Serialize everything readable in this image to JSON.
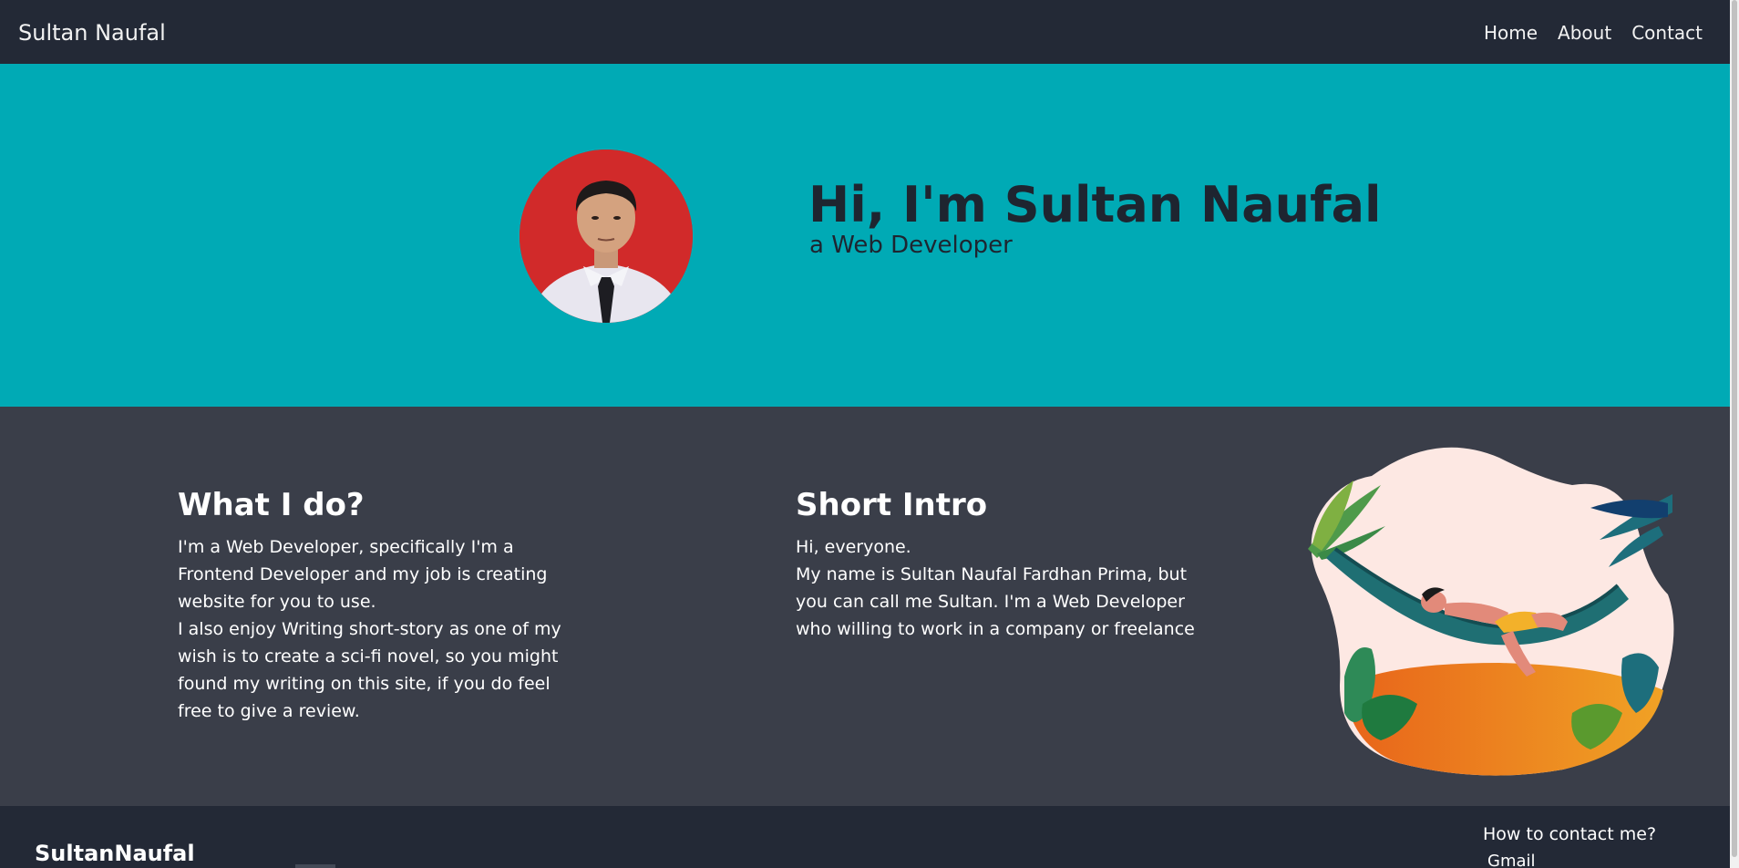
{
  "navbar": {
    "brand": "Sultan Naufal",
    "links": [
      "Home",
      "About",
      "Contact"
    ]
  },
  "hero": {
    "title": "Hi, I'm Sultan Naufal",
    "subtitle": "a Web Developer"
  },
  "about": {
    "what_i_do": {
      "heading": "What I do?",
      "paragraph1": "I'm a Web Developer, specifically I'm a Frontend Developer and my job is creating website for you to use.",
      "paragraph2": "I also enjoy Writing short-story as one of my wish is to create a sci-fi novel, so you might found my writing on this site, if you do feel free to give a review."
    },
    "short_intro": {
      "heading": "Short Intro",
      "paragraph1": "Hi, everyone.",
      "paragraph2": "My name is Sultan Naufal Fardhan Prima, but you can call me Sultan. I'm a Web Developer who willing to work in a company or freelance"
    }
  },
  "footer": {
    "brand": "SultanNaufal",
    "contact_title": "How to contact me?",
    "contact_gmail": "Gmail"
  },
  "colors": {
    "navbar": "#232936",
    "hero": "#00aab5",
    "about": "#3a3e49",
    "footer": "#232936"
  }
}
